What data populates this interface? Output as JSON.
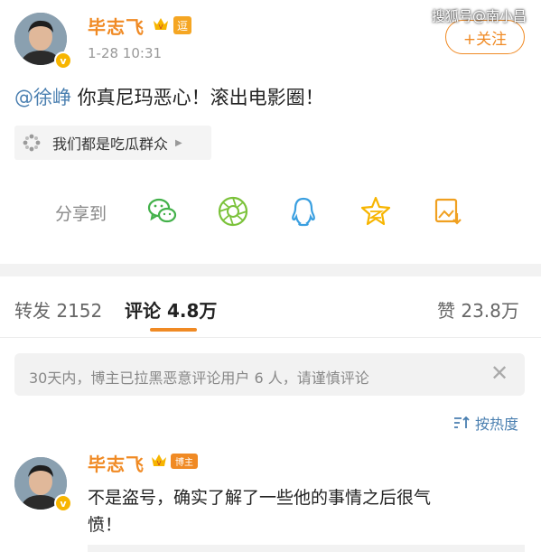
{
  "watermark": "搜狐号@南小昌",
  "post": {
    "author": "毕志飞",
    "badge": "逗",
    "time": "1-28 10:31",
    "follow_label": "+关注",
    "mention": "@徐峥",
    "text": " 你真尼玛恶心！滚出电影圈！",
    "topic": "我们都是吃瓜群众"
  },
  "share": {
    "label": "分享到",
    "targets": [
      "wechat-icon",
      "moments-icon",
      "qq-icon",
      "qzone-icon",
      "image-save-icon"
    ]
  },
  "tabs": {
    "repost": "转发 2152",
    "comment_label": "评论",
    "comment_count": "4.8万",
    "likes": "赞 23.8万"
  },
  "notice": "30天内，博主已拉黑恶意评论用户 6 人，请谨慎评论",
  "sort_label": "按热度",
  "comment": {
    "author": "毕志飞",
    "role": "博主",
    "text_line1": "不是盗号，确实了解了一些他的事情之后很气",
    "text_line2": "愤！"
  },
  "colors": {
    "accent": "#f08a24",
    "mention": "#4a7fb0",
    "wechat": "#43b14a",
    "qq": "#3a9fe0",
    "star": "#f7b500"
  }
}
